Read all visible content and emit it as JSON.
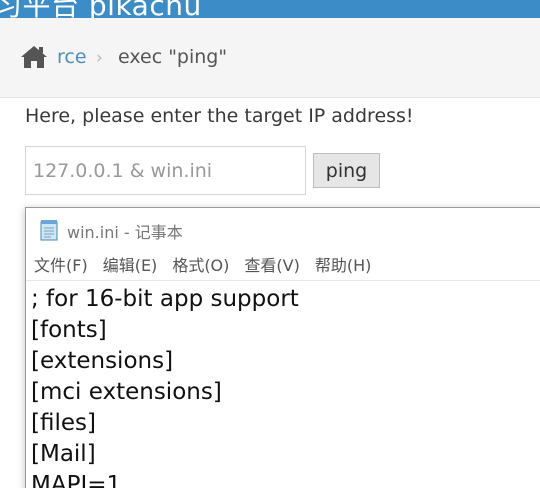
{
  "header": {
    "title": "习平台 pikachu",
    "background": "#3c8dc7"
  },
  "breadcrumb": {
    "home_icon": "home-icon",
    "link_label": "rce",
    "separator": "›",
    "current_label": "exec \"ping\"",
    "link_color": "#4c8fbd"
  },
  "form": {
    "instruction": "Here, please enter the target IP address!",
    "target_value": "127.0.0.1 & win.ini",
    "button_label": "ping"
  },
  "notepad": {
    "icon": "notepad-icon",
    "title": "win.ini - 记事本",
    "menu": [
      "文件(F)",
      "编辑(E)",
      "格式(O)",
      "查看(V)",
      "帮助(H)"
    ],
    "lines": [
      "; for 16-bit app support",
      "[fonts]",
      "[extensions]",
      "[mci extensions]",
      "[files]",
      "[Mail]",
      "MAPI=1"
    ]
  }
}
